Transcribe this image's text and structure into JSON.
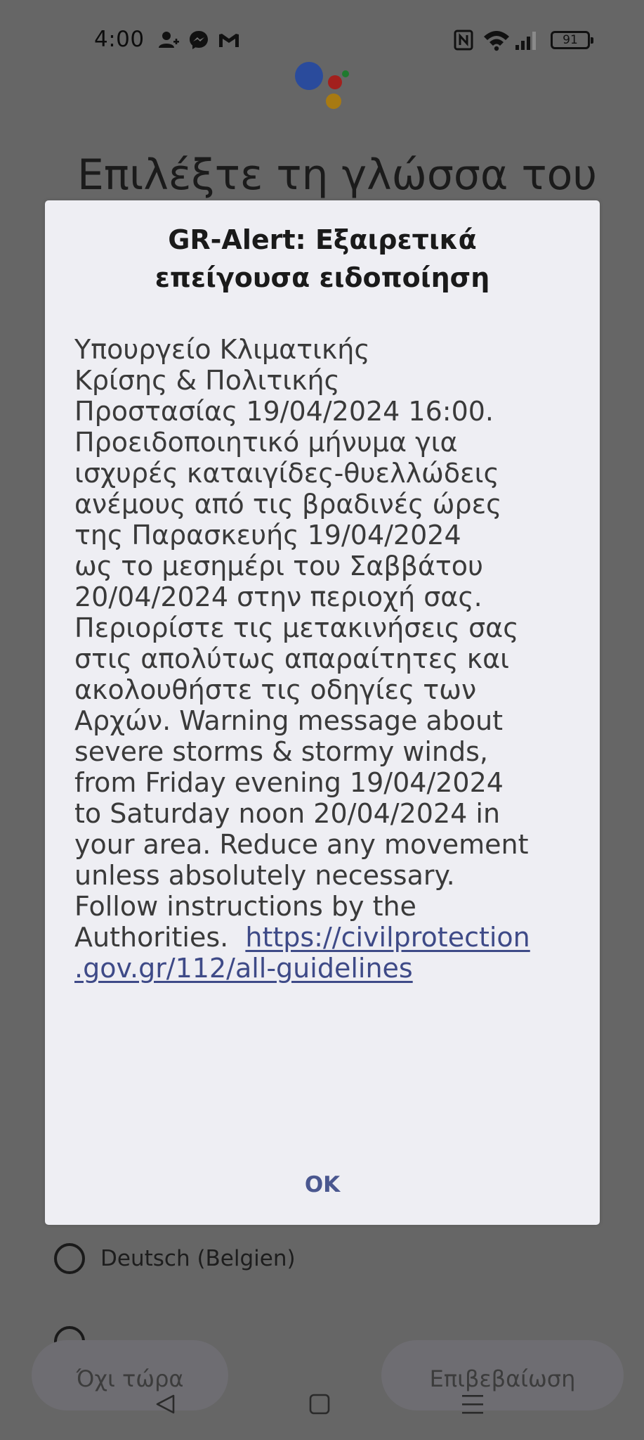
{
  "status_bar": {
    "time": "4:00",
    "battery_level": "91",
    "notification_icons": [
      "person-add-icon",
      "messenger-icon",
      "gmail-icon"
    ],
    "system_icons": [
      "nfc-icon",
      "wifi-icon",
      "signal-icon",
      "battery-icon"
    ]
  },
  "background_app": {
    "title": "Επιλέξτε τη γλώσσα του",
    "languages": [
      {
        "label": "Deutsch (Belgien)"
      }
    ],
    "not_now_label": "Όχι τώρα",
    "confirm_label": "Επιβεβαίωση"
  },
  "dialog": {
    "title_lines": [
      "GR-Alert: Εξαιρετικά",
      "επείγουσα ειδοποίηση"
    ],
    "body_lines": [
      "Υπουργείο Κλιματικής",
      "Κρίσης & Πολιτικής",
      "Προστασίας 19/04/2024 16:00.",
      "Προειδοποιητικό μήνυμα για",
      "ισχυρές καταιγίδες-θυελλώδεις",
      "ανέμους από τις βραδινές ώρες",
      "της Παρασκευής 19/04/2024",
      "ως το μεσημέρι του Σαββάτου",
      "20/04/2024 στην περιοχή σας.",
      "Περιορίστε τις μετακινήσεις σας",
      "στις απολύτως απαραίτητες και",
      "ακολουθήστε τις οδηγίες των",
      "Αρχών. Warning message about",
      "severe storms & stormy winds,",
      "from  Friday evening 19/04/2024",
      "to Saturday noon 20/04/2024 in",
      "your area. Reduce any movement",
      "unless absolutely necessary.",
      "Follow instructions by the"
    ],
    "last_line_text": "Authorities.  ",
    "link_part1": "https://civilprotection",
    "link_part2": ".gov.gr/112/all-guidelines",
    "ok_label": "OK"
  },
  "nav_bar": {
    "icons": [
      "back-icon",
      "home-icon",
      "recents-icon"
    ]
  },
  "colors": {
    "scrim": "#666666",
    "dialog_bg": "#eeeef3",
    "accent": "#4a578f",
    "assistant_blue": "#2a4b9c",
    "assistant_red": "#a3201d",
    "assistant_yellow": "#a87a12",
    "assistant_green": "#1f7a2e"
  }
}
